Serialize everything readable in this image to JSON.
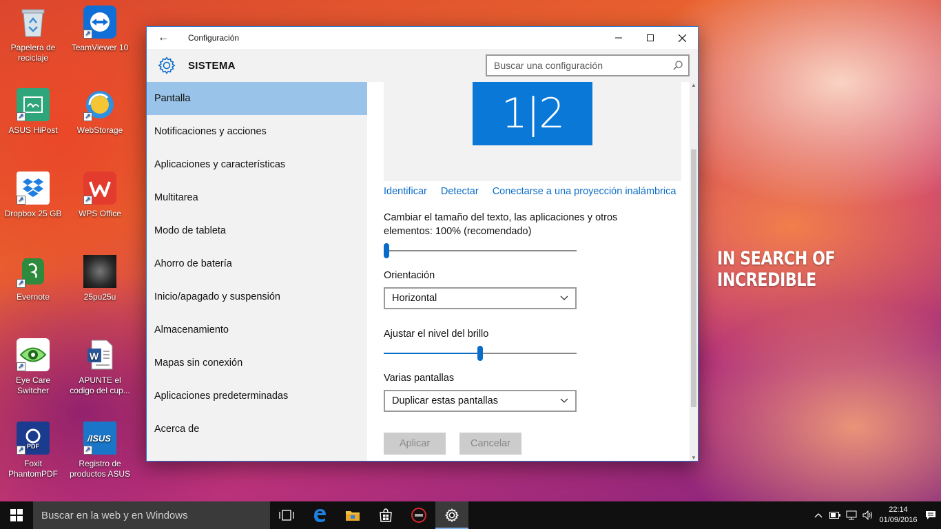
{
  "desktop": {
    "tagline": "IN SEARCH OF INCREDIBLE",
    "icons": [
      {
        "label": "Papelera de reciclaje",
        "icon": "recycle-bin-icon"
      },
      {
        "label": "TeamViewer 10",
        "icon": "teamviewer-icon"
      },
      {
        "label": "ASUS HiPost",
        "icon": "asus-hipost-icon"
      },
      {
        "label": "WebStorage",
        "icon": "webstorage-icon"
      },
      {
        "label": "Dropbox 25 GB",
        "icon": "dropbox-icon"
      },
      {
        "label": "WPS Office",
        "icon": "wps-office-icon"
      },
      {
        "label": "Evernote",
        "icon": "evernote-icon"
      },
      {
        "label": "25pu25u",
        "icon": "image-file-icon"
      },
      {
        "label": "Eye Care Switcher",
        "icon": "eye-care-icon"
      },
      {
        "label": "APUNTE el codigo del cup...",
        "icon": "word-document-icon"
      },
      {
        "label": "Foxit PhantomPDF",
        "icon": "foxit-pdf-icon"
      },
      {
        "label": "Registro de productos ASUS",
        "icon": "asus-registration-icon"
      }
    ]
  },
  "window": {
    "title": "Configuración",
    "section": "SISTEMA",
    "search_placeholder": "Buscar una configuración",
    "nav": [
      {
        "label": "Pantalla",
        "selected": true
      },
      {
        "label": "Notificaciones y acciones"
      },
      {
        "label": "Aplicaciones y características"
      },
      {
        "label": "Multitarea"
      },
      {
        "label": "Modo de tableta"
      },
      {
        "label": "Ahorro de batería"
      },
      {
        "label": "Inicio/apagado y suspensión"
      },
      {
        "label": "Almacenamiento"
      },
      {
        "label": "Mapas sin conexión"
      },
      {
        "label": "Aplicaciones predeterminadas"
      },
      {
        "label": "Acerca de"
      }
    ],
    "display": {
      "monitor_label": "1|2",
      "links": [
        "Identificar",
        "Detectar",
        "Conectarse a una proyección inalámbrica"
      ],
      "scale_label": "Cambiar el tamaño del texto, las aplicaciones y otros elementos: 100% (recomendado)",
      "scale_level": 0,
      "orientation_label": "Orientación",
      "orientation_value": "Horizontal",
      "brightness_label": "Ajustar el nivel del brillo",
      "brightness_level": 0.5,
      "multi_label": "Varias pantallas",
      "multi_value": "Duplicar estas pantallas",
      "apply_label": "Aplicar",
      "cancel_label": "Cancelar"
    }
  },
  "taskbar": {
    "search_placeholder": "Buscar en la web y en Windows",
    "time": "22:14",
    "date": "01/09/2016"
  },
  "colors": {
    "accent": "#0a78d7",
    "selection": "#99c3e8",
    "link": "#0a6cc9"
  }
}
